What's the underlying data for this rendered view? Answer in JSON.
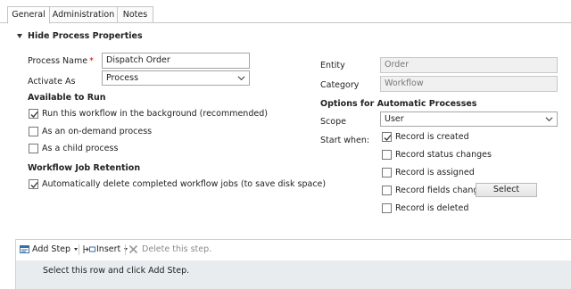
{
  "tabs": [
    {
      "label": "General",
      "active": true
    },
    {
      "label": "Administration",
      "active": false
    },
    {
      "label": "Notes",
      "active": false
    }
  ],
  "section": {
    "title": "Hide Process Properties"
  },
  "left": {
    "process_name_label": "Process Name",
    "process_name_required": "*",
    "process_name_value": "Dispatch Order",
    "activate_as_label": "Activate As",
    "activate_as_value": "Process",
    "available_to_run_heading": "Available to Run",
    "options": [
      {
        "label": "Run this workflow in the background (recommended)",
        "checked": true
      },
      {
        "label": "As an on-demand process",
        "checked": false
      },
      {
        "label": "As a child process",
        "checked": false
      }
    ],
    "retention_heading": "Workflow Job Retention",
    "retention_option": {
      "label": "Automatically delete completed workflow jobs (to save disk space)",
      "checked": true
    }
  },
  "right": {
    "entity_label": "Entity",
    "entity_value": "Order",
    "category_label": "Category",
    "category_value": "Workflow",
    "auto_heading": "Options for Automatic Processes",
    "scope_label": "Scope",
    "scope_value": "User",
    "start_when_label": "Start when:",
    "triggers": [
      {
        "label": "Record is created",
        "checked": true
      },
      {
        "label": "Record status changes",
        "checked": false
      },
      {
        "label": "Record is assigned",
        "checked": false
      },
      {
        "label": "Record fields change",
        "checked": false
      },
      {
        "label": "Record is deleted",
        "checked": false
      }
    ],
    "select_button": "Select"
  },
  "steps": {
    "add_step": "Add Step",
    "insert": "Insert",
    "delete": "Delete this step.",
    "hint": "Select this row and click Add Step."
  },
  "icons": [
    "add-step-icon",
    "insert-icon",
    "delete-icon",
    "dropdown-chevron-icon",
    "checkmark-icon",
    "collapse-triangle-icon"
  ]
}
